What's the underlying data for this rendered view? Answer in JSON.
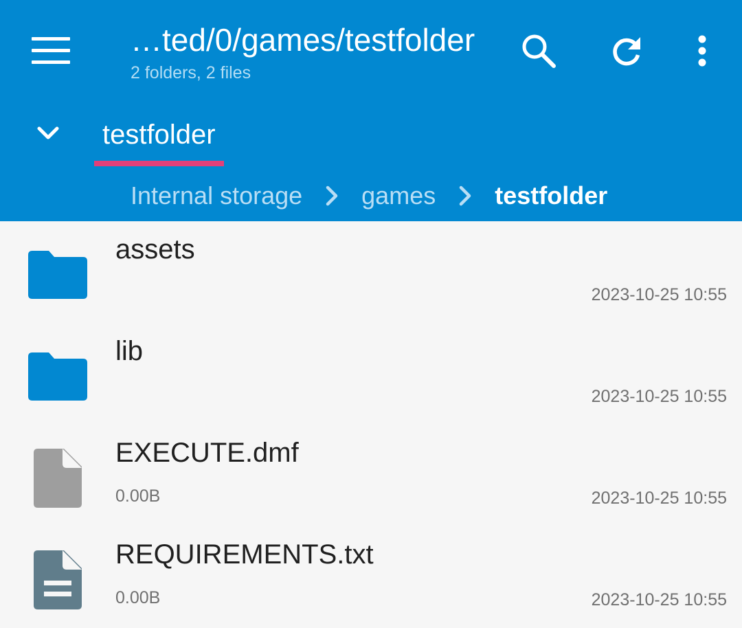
{
  "colors": {
    "toolbar": "#0288d1",
    "tab_indicator": "#e2407a",
    "folder_icon": "#0288d1",
    "file_icon": "#9e9e9e",
    "text_file_icon": "#607d8b"
  },
  "toolbar": {
    "menu_icon": "hamburger-menu-icon",
    "title": "…ted/0/games/testfolder",
    "subtitle": "2 folders, 2 files",
    "search_icon": "search-icon",
    "refresh_icon": "refresh-icon",
    "more_icon": "more-vertical-icon"
  },
  "tabs": {
    "expand_icon": "chevron-down-icon",
    "items": [
      {
        "label": "testfolder",
        "selected": true
      }
    ]
  },
  "breadcrumb": {
    "items": [
      "Internal storage",
      "games",
      "testfolder"
    ],
    "separator_icon": "chevron-right-icon"
  },
  "files": [
    {
      "name": "assets",
      "type": "folder",
      "size": "",
      "date": "2023-10-25 10:55",
      "icon": "folder-icon"
    },
    {
      "name": "lib",
      "type": "folder",
      "size": "",
      "date": "2023-10-25 10:55",
      "icon": "folder-icon"
    },
    {
      "name": "EXECUTE.dmf",
      "type": "file",
      "size": "0.00B",
      "date": "2023-10-25 10:55",
      "icon": "file-icon"
    },
    {
      "name": "REQUIREMENTS.txt",
      "type": "text",
      "size": "0.00B",
      "date": "2023-10-25 10:55",
      "icon": "text-file-icon"
    }
  ]
}
